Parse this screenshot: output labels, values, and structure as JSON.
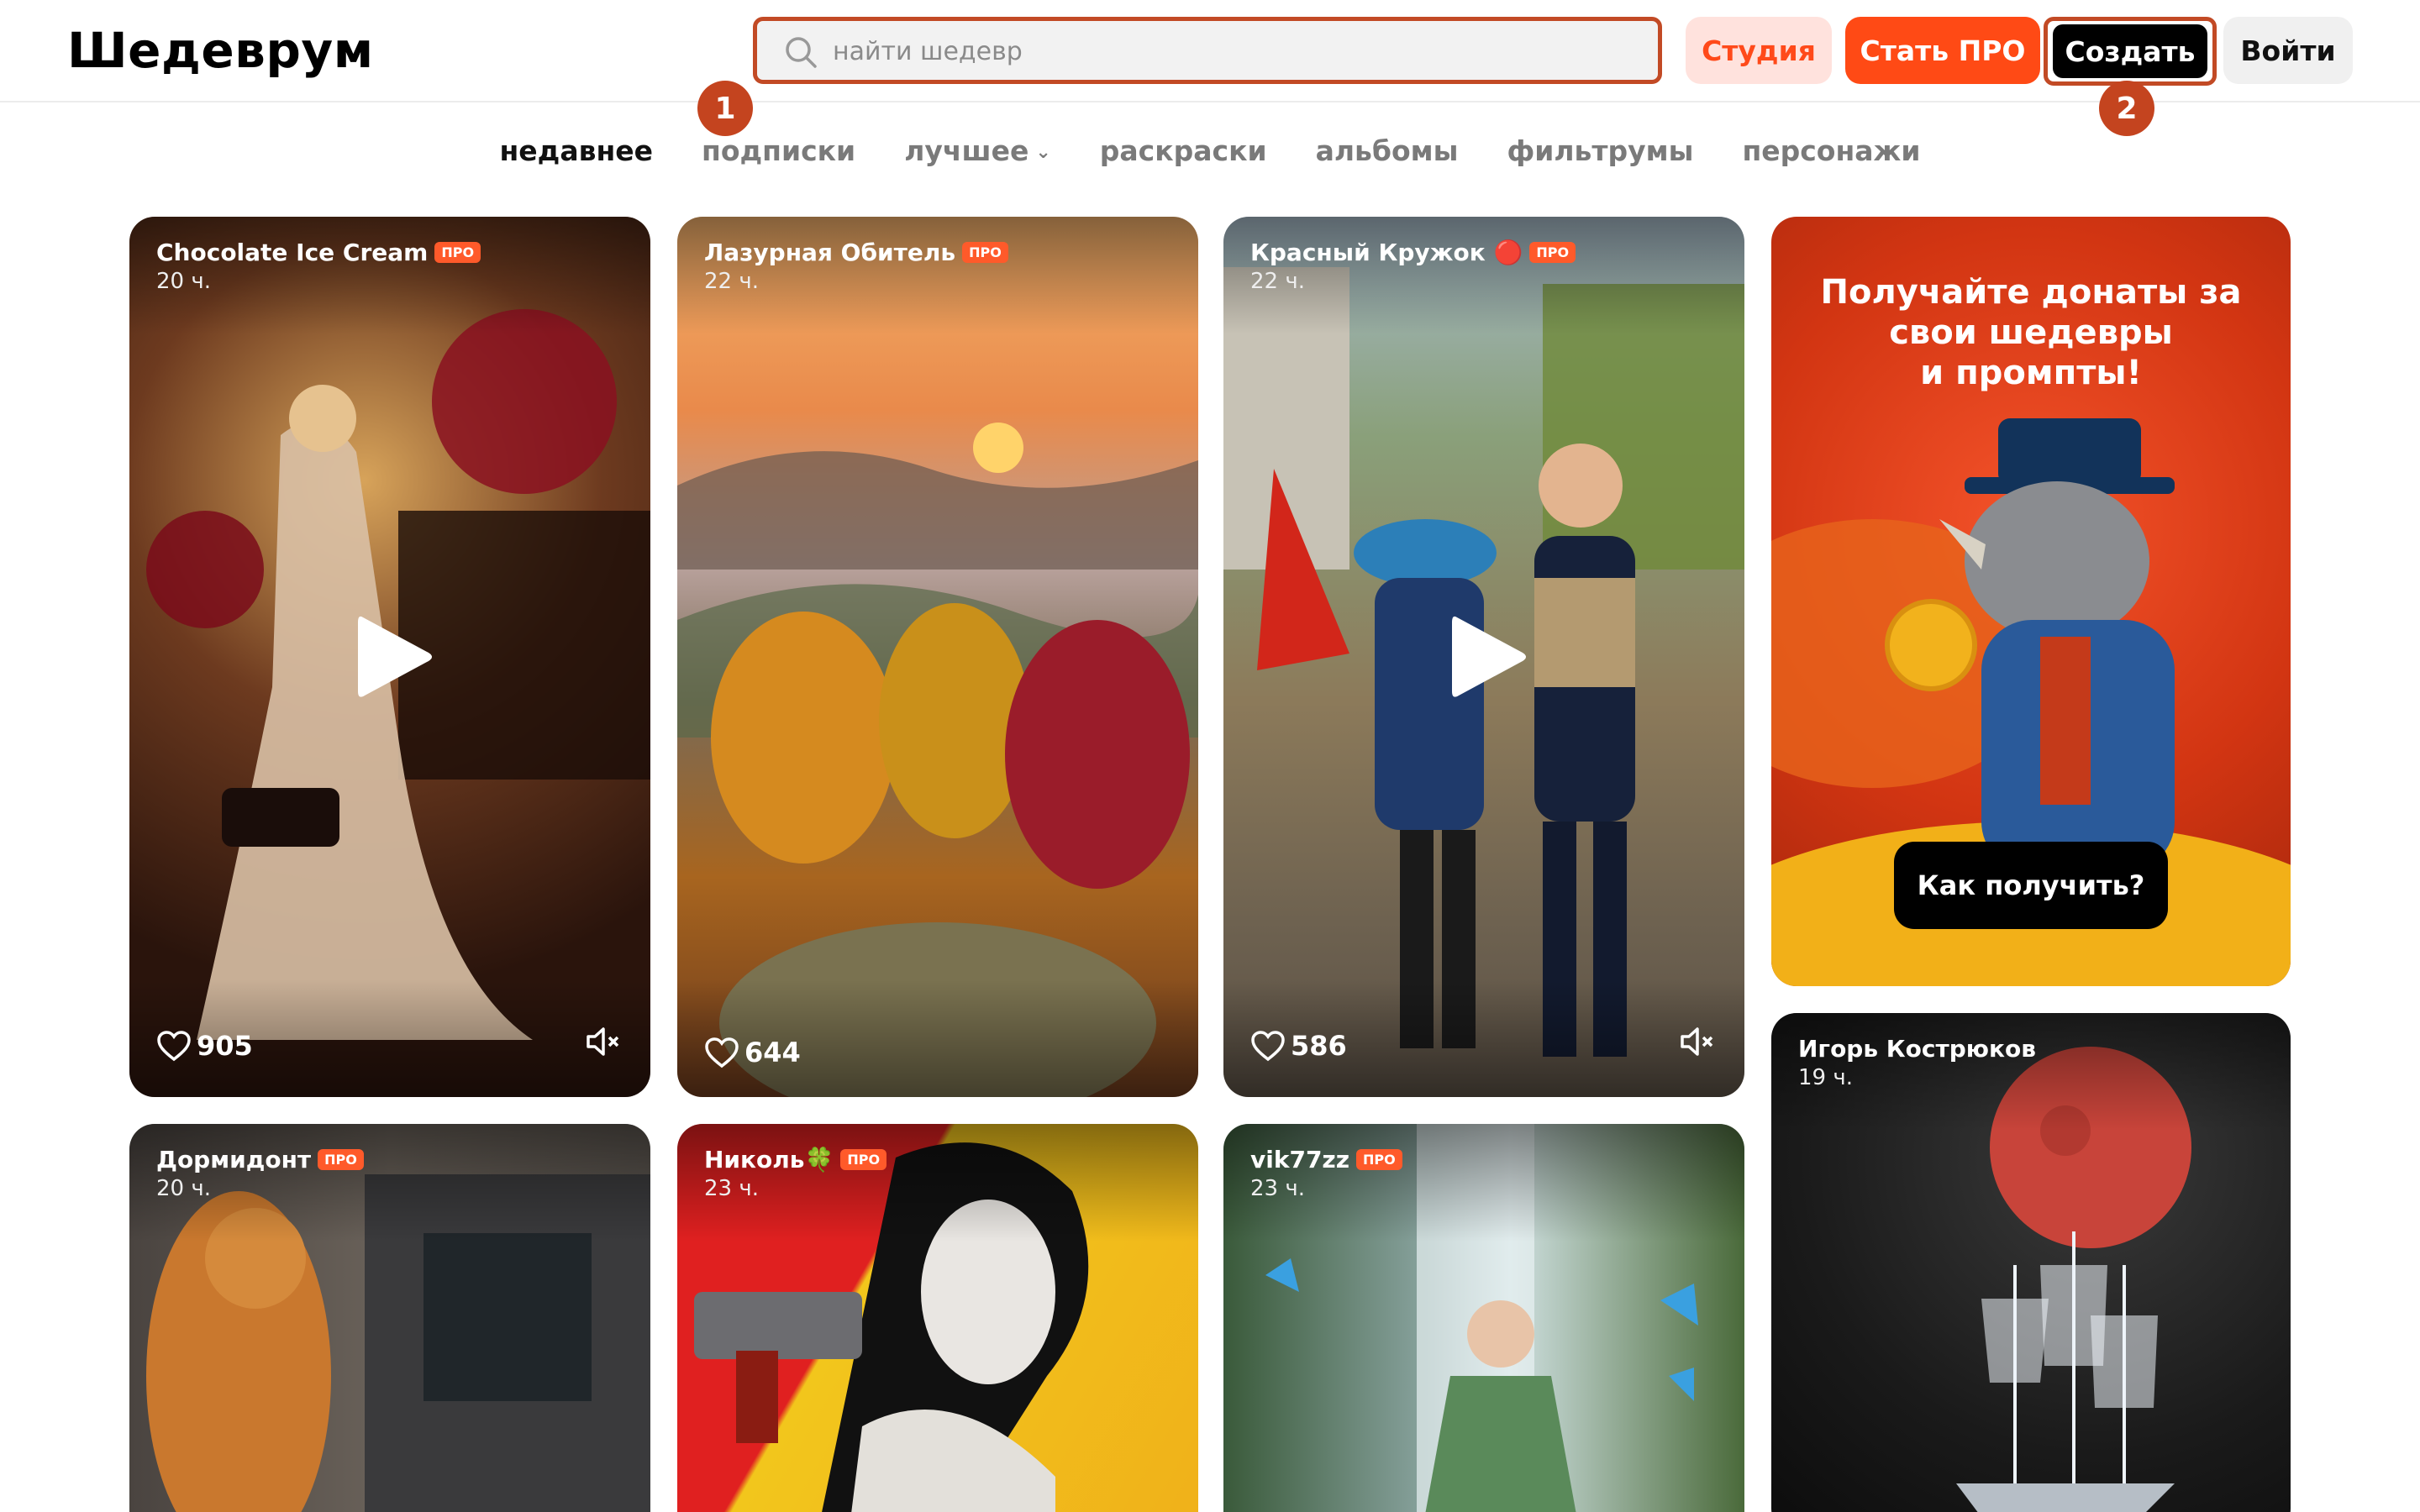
{
  "header": {
    "logo": "Шедеврум",
    "search_placeholder": "найти шедевр",
    "studio_label": "Студия",
    "pro_label": "Стать ПРО",
    "create_label": "Создать",
    "login_label": "Войти",
    "markers": [
      "1",
      "2"
    ]
  },
  "tabs": [
    {
      "label": "недавнее",
      "active": true
    },
    {
      "label": "подписки"
    },
    {
      "label": "лучшее"
    },
    {
      "label": "раскраски"
    },
    {
      "label": "альбомы"
    },
    {
      "label": "фильтрумы"
    },
    {
      "label": "персонажи"
    }
  ],
  "pro_badge": "ПРО",
  "cards": [
    {
      "author": "Chocolate Ice Cream",
      "time": "20 ч.",
      "likes": "905",
      "video": true
    },
    {
      "author": "Лазурная Обитель",
      "time": "22 ч.",
      "likes": "644",
      "video": false
    },
    {
      "author": "Красный Кружок 🔴",
      "time": "22 ч.",
      "likes": "586",
      "video": true
    },
    {
      "author": "Дормидонт",
      "time": "20 ч."
    },
    {
      "author": "Николь🍀",
      "time": "23 ч."
    },
    {
      "author": "vik77zz",
      "time": "23 ч."
    },
    {
      "author": "Игорь Кострюков",
      "time": "19 ч."
    }
  ],
  "ad": {
    "text_line1": "Получайте донаты за",
    "text_line2": "свои шедевры",
    "text_line3": "и промпты!",
    "button": "Как получить?"
  },
  "colors": {
    "accent": "#ff4a15",
    "accent_light": "#ffe2dd",
    "annotation": "#c4441f"
  }
}
